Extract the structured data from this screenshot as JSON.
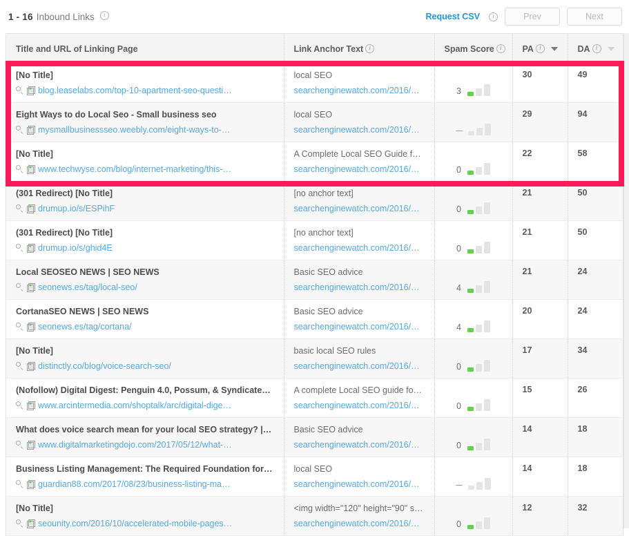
{
  "header": {
    "range": "1 - 16",
    "range_label": "Inbound Links",
    "info_icon": "info-icon",
    "request_csv": "Request CSV",
    "prev_label": "Prev",
    "next_label": "Next"
  },
  "colors": {
    "highlight": "#fc1a59",
    "link": "#52a8e8",
    "accent_link": "#2196dd",
    "spam_bar_on": "#62d14e",
    "spam_bar_off": "#e4e4e4"
  },
  "table": {
    "columns": [
      {
        "key": "title",
        "label": "Title and URL of Linking Page",
        "info": false,
        "sort": "none"
      },
      {
        "key": "anchor",
        "label": "Link Anchor Text",
        "info": true,
        "sort": "none"
      },
      {
        "key": "spam",
        "label": "Spam Score",
        "info": true,
        "sort": "none"
      },
      {
        "key": "pa",
        "label": "PA",
        "info": true,
        "sort": "active"
      },
      {
        "key": "da",
        "label": "DA",
        "info": true,
        "sort": "inactive"
      }
    ],
    "rows": [
      {
        "title": "[No Title]",
        "url": "blog.leaselabs.com/top-10-apartment-seo-questi…",
        "anchor": "local SEO",
        "anchor_url": "searchenginewatch.com/2016/…",
        "spam": "3",
        "spam_level": 1,
        "pa": "30",
        "da": "49",
        "highlighted": true
      },
      {
        "title": "Eight Ways to do Local Seo - Small business seo",
        "url": "mysmallbusinessseo.weebly.com/eight-ways-to-…",
        "anchor": "local SEO",
        "anchor_url": "searchenginewatch.com/2016/…",
        "spam": "---",
        "spam_level": 0,
        "pa": "29",
        "da": "94",
        "highlighted": true
      },
      {
        "title": "[No Title]",
        "url": "www.techwyse.com/blog/internet-marketing/this-…",
        "anchor": "A Complete Local SEO Guide f…",
        "anchor_url": "searchenginewatch.com/2016/…",
        "spam": "0",
        "spam_level": 1,
        "pa": "22",
        "da": "58",
        "highlighted": true
      },
      {
        "title": "(301 Redirect) [No Title]",
        "url": "drumup.io/s/ESPihF",
        "anchor": "[no anchor text]",
        "anchor_url": "searchenginewatch.com/2016/…",
        "spam": "0",
        "spam_level": 1,
        "pa": "21",
        "da": "50",
        "highlighted": false
      },
      {
        "title": "(301 Redirect) [No Title]",
        "url": "drumup.io/s/ghid4E",
        "anchor": "[no anchor text]",
        "anchor_url": "searchenginewatch.com/2016/…",
        "spam": "0",
        "spam_level": 1,
        "pa": "21",
        "da": "50",
        "highlighted": false
      },
      {
        "title": "Local SEOSEO NEWS | SEO NEWS",
        "url": "seonews.es/tag/local-seo/",
        "anchor": "Basic SEO advice",
        "anchor_url": "searchenginewatch.com/2016/…",
        "spam": "4",
        "spam_level": 1,
        "pa": "21",
        "da": "24",
        "highlighted": false
      },
      {
        "title": "CortanaSEO NEWS | SEO NEWS",
        "url": "seonews.es/tag/cortana/",
        "anchor": "Basic SEO advice",
        "anchor_url": "searchenginewatch.com/2016/…",
        "spam": "4",
        "spam_level": 1,
        "pa": "20",
        "da": "24",
        "highlighted": false
      },
      {
        "title": "[No Title]",
        "url": "distinctly.co/blog/voice-search-seo/",
        "anchor": "basic local SEO rules",
        "anchor_url": "searchenginewatch.com/2016/…",
        "spam": "0",
        "spam_level": 1,
        "pa": "17",
        "da": "34",
        "highlighted": false
      },
      {
        "title": "(Nofollow) Digital Digest: Penguin 4.0, Possum, & Syndicated …",
        "url": "www.arcintermedia.com/shoptalk/arc/digital-dige…",
        "anchor": "A complete Local SEO guide fo…",
        "anchor_url": "searchenginewatch.com/2016/…",
        "spam": "0",
        "spam_level": 1,
        "pa": "15",
        "da": "26",
        "highlighted": false
      },
      {
        "title": "What does voice search mean for your local SEO strategy? | D…",
        "url": "www.digitalmarketingdojo.com/2017/05/12/what-…",
        "anchor": "Basic SEO advice",
        "anchor_url": "searchenginewatch.com/2016/…",
        "spam": "0",
        "spam_level": 1,
        "pa": "14",
        "da": "18",
        "highlighted": false
      },
      {
        "title": "Business Listing Management: The Required Foundation for L…",
        "url": "guardian88.com/2017/08/23/business-listing-ma…",
        "anchor": "local SEO",
        "anchor_url": "searchenginewatch.com/2016/…",
        "spam": "---",
        "spam_level": 0,
        "pa": "14",
        "da": "18",
        "highlighted": false
      },
      {
        "title": "[No Title]",
        "url": "seounity.com/2016/10/accelerated-mobile-pages…",
        "anchor": "<img width=\"120\" height=\"90\" s…",
        "anchor_url": "searchenginewatch.com/2016/…",
        "spam": "0",
        "spam_level": 1,
        "pa": "12",
        "da": "32",
        "highlighted": false
      }
    ]
  }
}
